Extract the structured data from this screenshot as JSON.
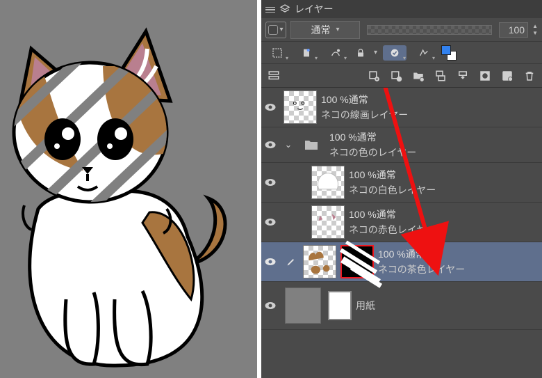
{
  "panel": {
    "title": "レイヤー"
  },
  "blend": {
    "mode": "通常",
    "opacity": "100"
  },
  "layers": [
    {
      "opacity": "100 %通常",
      "name": "ネコの線画レイヤー"
    },
    {
      "opacity": "100 %通常",
      "name": "ネコの色のレイヤー"
    },
    {
      "opacity": "100 %通常",
      "name": "ネコの白色レイヤー"
    },
    {
      "opacity": "100 %通常",
      "name": "ネコの赤色レイヤー"
    },
    {
      "opacity": "100 %通常",
      "name": "ネコの茶色レイヤー"
    },
    {
      "name": "用紙"
    }
  ]
}
